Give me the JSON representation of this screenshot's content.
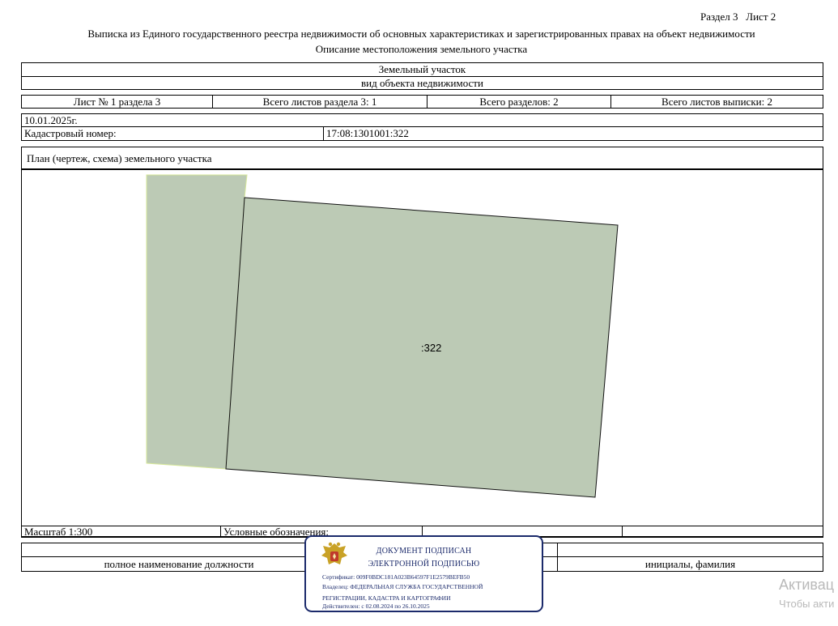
{
  "header": {
    "section_sheet": "Раздел 3   Лист 2",
    "title": "Выписка из Единого государственного реестра недвижимости об основных характеристиках и зарегистрированных правах на объект недвижимости",
    "subtitle": "Описание местоположения земельного участка"
  },
  "object": {
    "type": "Земельный участок",
    "type_caption": "вид объекта недвижимости"
  },
  "sheet_info": {
    "sheet": "Лист № 1 раздела 3",
    "total_section_sheets": "Всего листов раздела 3: 1",
    "total_sections": "Всего разделов: 2",
    "total_extract_sheets": "Всего листов выписки: 2"
  },
  "date": "10.01.2025г.",
  "cadastral": {
    "label": "Кадастровый номер:",
    "value": "17:08:1301001:322"
  },
  "plan": {
    "title": "План (чертеж, схема) земельного участка",
    "parcel_label": ":322",
    "fill_color": "#bccab5",
    "edge_color": "#d7e89a"
  },
  "footer": {
    "scale": "Масштаб 1:300",
    "legend": "Условные обозначения:",
    "position_caption": "полное наименование должности",
    "name_caption": "инициалы, фамилия"
  },
  "stamp": {
    "line1": "ДОКУМЕНТ ПОДПИСАН",
    "line2": "ЭЛЕКТРОННОЙ ПОДПИСЬЮ",
    "certificate": "Сертификат: 009F0BDC181A023B64597F1E2579BEFB50",
    "owner_line1": "Владелец: ФЕДЕРАЛЬНАЯ СЛУЖБА ГОСУДАРСТВЕННОЙ",
    "owner_line2": "РЕГИСТРАЦИИ, КАДАСТРА И КАРТОГРАФИИ",
    "valid": "Действителен: с 02.08.2024 по 26.10.2025",
    "color": "#1b2a6b"
  },
  "windows_watermark": {
    "line1": "Активац",
    "line2": "Чтобы акти"
  }
}
